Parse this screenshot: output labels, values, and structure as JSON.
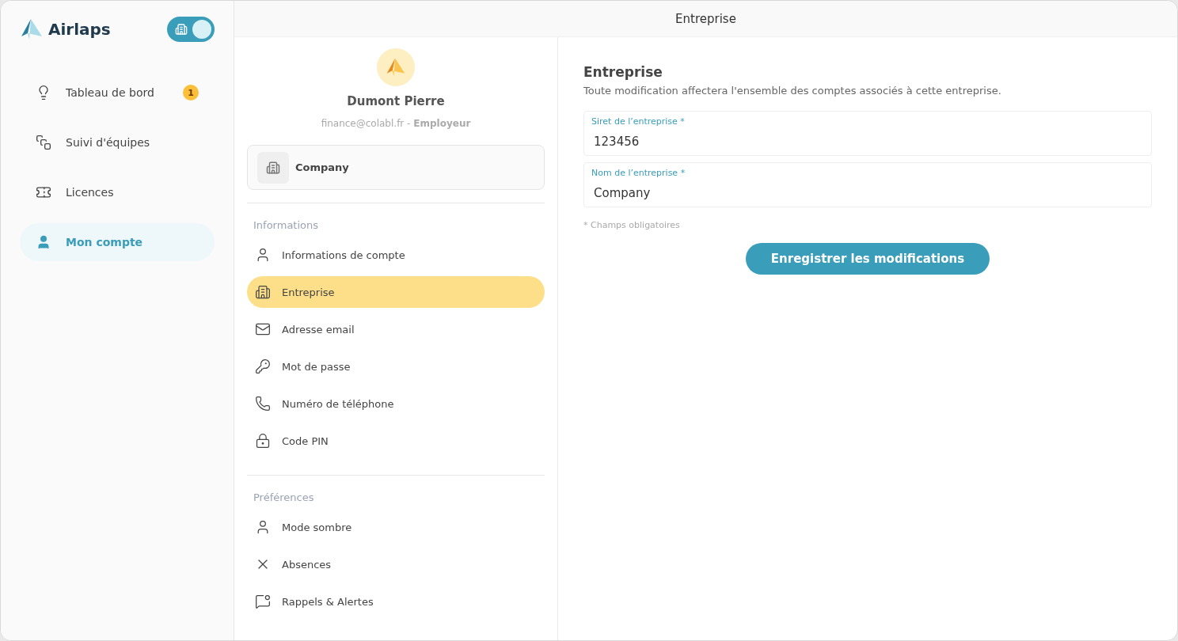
{
  "brand": {
    "name": "Airlaps"
  },
  "mode_toggle": {
    "on": true
  },
  "sidebar": {
    "items": [
      {
        "label": "Tableau de bord",
        "badge": "1",
        "selected": false
      },
      {
        "label": "Suivi d'équipes",
        "selected": false
      },
      {
        "label": "Licences",
        "selected": false
      },
      {
        "label": "Mon compte",
        "selected": true
      }
    ]
  },
  "header": {
    "title": "Entreprise"
  },
  "profile": {
    "name": "Dumont Pierre",
    "subtitle": "finance@colabl.fr - **Employeur**",
    "company": "Company"
  },
  "menu_sections": [
    {
      "title": "Informations",
      "items": [
        {
          "label": "Informations de compte",
          "selected": false
        },
        {
          "label": "Entreprise",
          "selected": true
        },
        {
          "label": "Adresse email",
          "selected": false
        },
        {
          "label": "Mot de passe",
          "selected": false
        },
        {
          "label": "Numéro de téléphone",
          "selected": false
        },
        {
          "label": "Code PIN",
          "selected": false
        }
      ]
    },
    {
      "title": "Préférences",
      "items": [
        {
          "label": "Mode sombre",
          "selected": false
        },
        {
          "label": "Absences",
          "selected": false
        },
        {
          "label": "Rappels & Alertes",
          "selected": false
        }
      ]
    }
  ],
  "form": {
    "title": "Entreprise",
    "description": "Toute modification affectera l'ensemble des comptes associés à cette entreprise.",
    "fields": [
      {
        "label": "Siret de l’entreprise *",
        "value": "123456"
      },
      {
        "label": "Nom de l’entreprise *",
        "value": "Company"
      }
    ],
    "note": "* Champs obligatoires",
    "submit": "Enregistrer les modifications"
  }
}
